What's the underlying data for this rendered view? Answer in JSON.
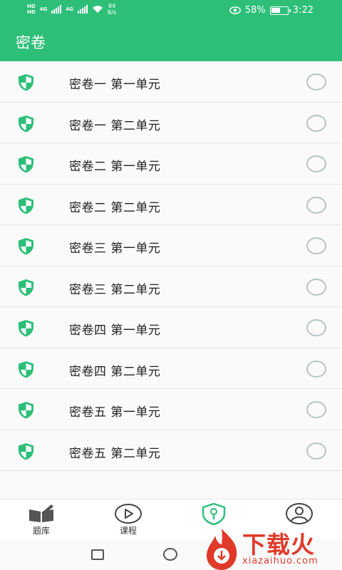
{
  "status_bar": {
    "network_label": "HD",
    "network_type": "4G",
    "speed_value": "84",
    "speed_unit": "B/s",
    "battery_percent": "58%",
    "battery_level": 0.58,
    "time": "3:22"
  },
  "header": {
    "title": "密卷"
  },
  "list": {
    "items": [
      {
        "label": "密卷一 第一单元",
        "selected": false
      },
      {
        "label": "密卷一 第二单元",
        "selected": false
      },
      {
        "label": "密卷二 第一单元",
        "selected": false
      },
      {
        "label": "密卷二 第二单元",
        "selected": false
      },
      {
        "label": "密卷三 第一单元",
        "selected": false
      },
      {
        "label": "密卷三 第二单元",
        "selected": false
      },
      {
        "label": "密卷四 第一单元",
        "selected": false
      },
      {
        "label": "密卷四 第二单元",
        "selected": false
      },
      {
        "label": "密卷五 第一单元",
        "selected": false
      },
      {
        "label": "密卷五 第二单元",
        "selected": false
      }
    ]
  },
  "bottom_nav": {
    "tabs": [
      {
        "label": "题库",
        "icon": "book-pen-icon"
      },
      {
        "label": "课程",
        "icon": "play-circle-icon"
      },
      {
        "label": "",
        "icon": "shield-key-icon",
        "active": true
      },
      {
        "label": "",
        "icon": "user-circle-icon"
      }
    ]
  },
  "watermark": {
    "text": "下载火",
    "url": "xiazaihuo.com"
  },
  "colors": {
    "primary": "#2dbf78",
    "radio_border": "#b9c3c4",
    "watermark": "#e03a2b"
  }
}
